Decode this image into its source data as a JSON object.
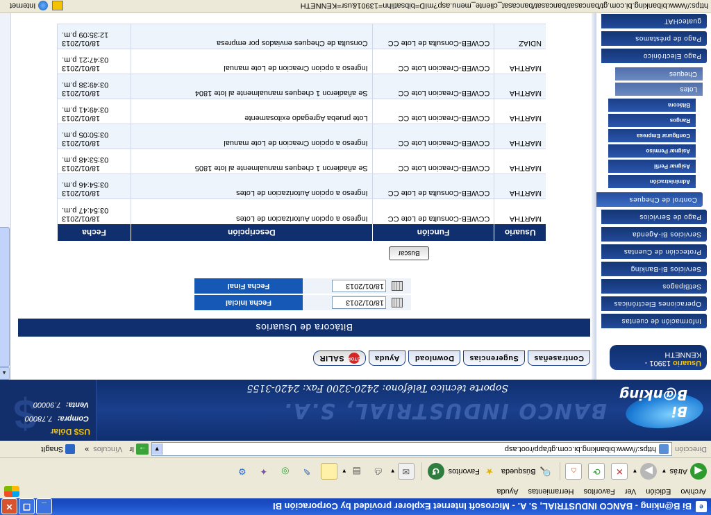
{
  "window": {
    "title": "Bi B@nking - BANCO INDUSTRIAL, S. A. - Microsoft Internet Explorer provided by Corporación BI",
    "icon_letter": "e"
  },
  "menubar": [
    "Archivo",
    "Edición",
    "Ver",
    "Favoritos",
    "Herramientas",
    "Ayuda"
  ],
  "toolbar": {
    "back_label": "Atrás",
    "search_label": "Búsqueda",
    "favorites_label": "Favoritos"
  },
  "addressbar": {
    "label": "Dirección",
    "url": "https://www.bibanking.bi.com.gt/app/root.asp",
    "go_label": "Ir",
    "links_label": "Vínculos",
    "chevron": "»",
    "snagit_label": "SnagIt"
  },
  "header": {
    "logo_text": "Bi B@nking",
    "bank_name": "BANCO INDUSTRIAL, S.A.",
    "support_text": "Soporte técnico  Teléfono: 2420-3200  Fax: 2420-3155",
    "dollar": {
      "title": "US$ Dólar",
      "compra_label": "Compra:",
      "compra_value": "7.78000",
      "venta_label": "Venta:",
      "venta_value": "7.90000"
    }
  },
  "user": {
    "label": "Usuario",
    "id": "13901 -",
    "name": "KENNETH"
  },
  "sidebar": {
    "items": [
      "Información de cuentas",
      "Operaciones Electrónicas",
      "SetBipagos",
      "Servicios Bi-Banking",
      "Protección de Cuentas",
      "Servicios Bi-Agenda",
      "Pago de Servicios",
      "Control de Cheques"
    ],
    "control_sub": [
      "Administración",
      "Asignar Perfil",
      "Asignar Permiso",
      "Configurar Empresa",
      "Rangos",
      "Bitácora"
    ],
    "cheque_sub": [
      "Lotes",
      "Cheques"
    ],
    "bottom_items": [
      "Pago Electrónico",
      "Pago de préstamos",
      "guatecHAT"
    ]
  },
  "tabs": {
    "contrasenas": "Contraseñas",
    "sugerencias": "Sugerencias",
    "download": "Download",
    "ayuda": "Ayuda",
    "salir": "SALIR",
    "stop": "STOP"
  },
  "page": {
    "title": "Bitácora de Usuarios",
    "fecha_inicial_label": "Fecha Inicial",
    "fecha_inicial_value": "18/01/2013",
    "fecha_final_label": "Fecha Final",
    "fecha_final_value": "18/01/2013",
    "buscar_label": "Buscar"
  },
  "table": {
    "headers": [
      "Usuario",
      "Función",
      "Descripción",
      "Fecha"
    ],
    "rows": [
      {
        "usuario": "MARTHA",
        "funcion": "CCWEB-Consulta de Lote CC",
        "descripcion": "Ingreso a opcion Autorizacion de Lotes",
        "fecha": "18/01/2013 03:54:47 p.m."
      },
      {
        "usuario": "MARTHA",
        "funcion": "CCWEB-Consulta de Lote CC",
        "descripcion": "Ingreso a opcion Autorizacion de Lotes",
        "fecha": "18/01/2013 03:54:46 p.m."
      },
      {
        "usuario": "MARTHA",
        "funcion": "CCWEB-Creacion Lote CC",
        "descripcion": "Se añadieron 1 cheques manualmente al lote 1805",
        "fecha": "18/01/2013 03:53:48 p.m."
      },
      {
        "usuario": "MARTHA",
        "funcion": "CCWEB-Creacion Lote CC",
        "descripcion": "Ingreso a opcion Creacion de Lote manual",
        "fecha": "18/01/2013 03:50:05 p.m."
      },
      {
        "usuario": "MARTHA",
        "funcion": "CCWEB-Creacion Lote CC",
        "descripcion": "Lote prueba Agregado exitosamente",
        "fecha": "18/01/2013 03:49:41 p.m."
      },
      {
        "usuario": "MARTHA",
        "funcion": "CCWEB-Creacion Lote CC",
        "descripcion": "Se añadieron 1 cheques manualmente al lote 1804",
        "fecha": "18/01/2013 03:49:38 p.m."
      },
      {
        "usuario": "MARTHA",
        "funcion": "CCWEB-Creacion Lote CC",
        "descripcion": "Ingreso a opcion Creacion de Lote manual",
        "fecha": "18/01/2013 03:47:21 p.m."
      },
      {
        "usuario": "NDIAZ",
        "funcion": "CCWEB-Consulta de Lote CC",
        "descripcion": "Consulta de Cheques enviados por empresa",
        "fecha": "18/01/2013 12:35:09 p.m."
      }
    ]
  },
  "statusbar": {
    "text": "https://www.bibanking.bi.com.gt/bancasat/bancasat/bancasat_cliente_menu.asp?mID=bibsatlihn=13901&usr=KENNETH",
    "zone": "Internet"
  }
}
